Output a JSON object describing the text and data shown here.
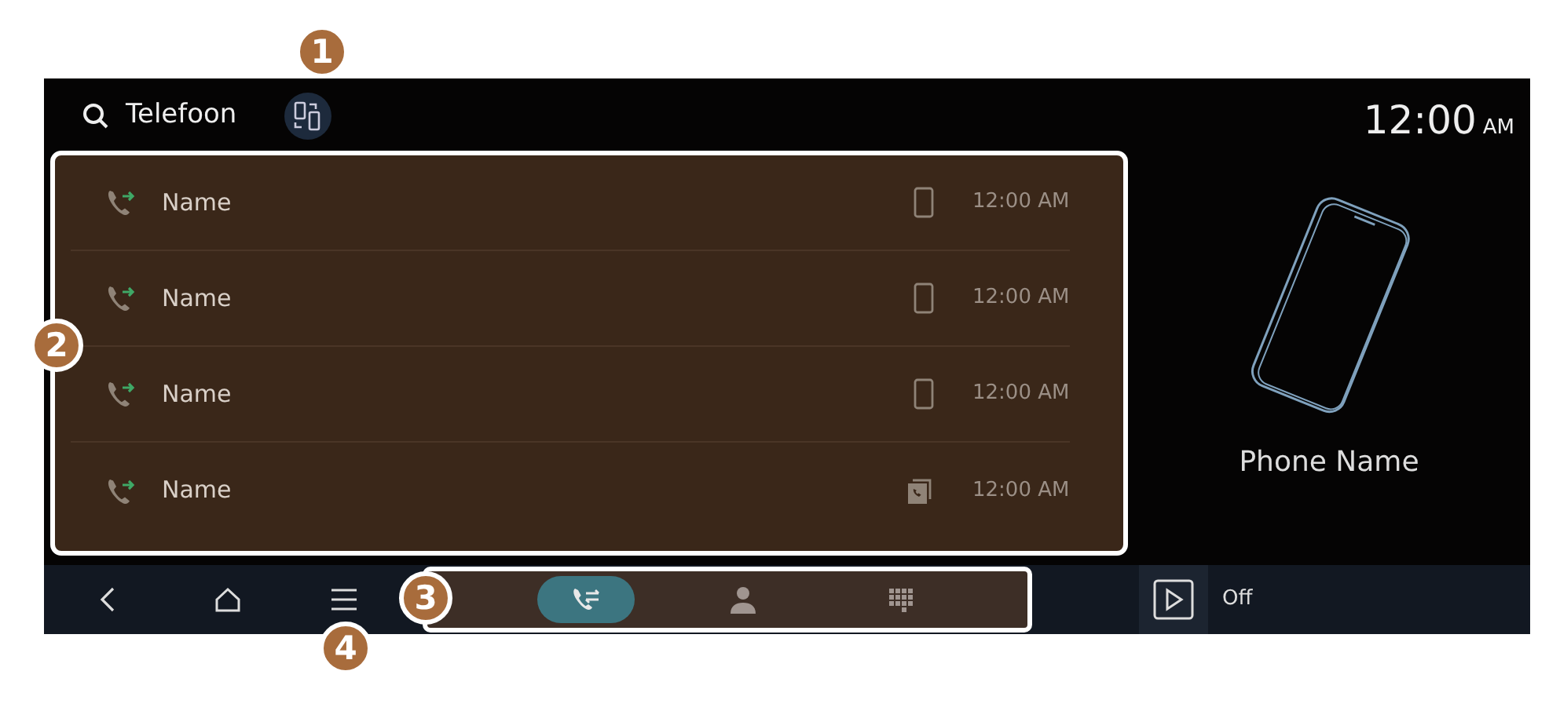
{
  "header": {
    "title": "Telefoon"
  },
  "clock": {
    "time": "12:00",
    "ampm": "AM"
  },
  "calls": [
    {
      "name": "Name",
      "kind": "phone",
      "time": "12:00 AM"
    },
    {
      "name": "Name",
      "kind": "phone",
      "time": "12:00 AM"
    },
    {
      "name": "Name",
      "kind": "phone",
      "time": "12:00 AM"
    },
    {
      "name": "Name",
      "kind": "car",
      "time": "12:00 AM"
    }
  ],
  "device": {
    "name": "Phone Name"
  },
  "tabs": [
    {
      "kind": "calls",
      "selected": true
    },
    {
      "kind": "contacts",
      "selected": false
    },
    {
      "kind": "keypad",
      "selected": false
    }
  ],
  "media": {
    "label": "Off"
  },
  "callouts": [
    {
      "number": "1",
      "kind": "switch"
    },
    {
      "number": "2",
      "kind": "list"
    },
    {
      "number": "3",
      "kind": "tabs"
    },
    {
      "number": "4",
      "kind": "menu"
    }
  ]
}
